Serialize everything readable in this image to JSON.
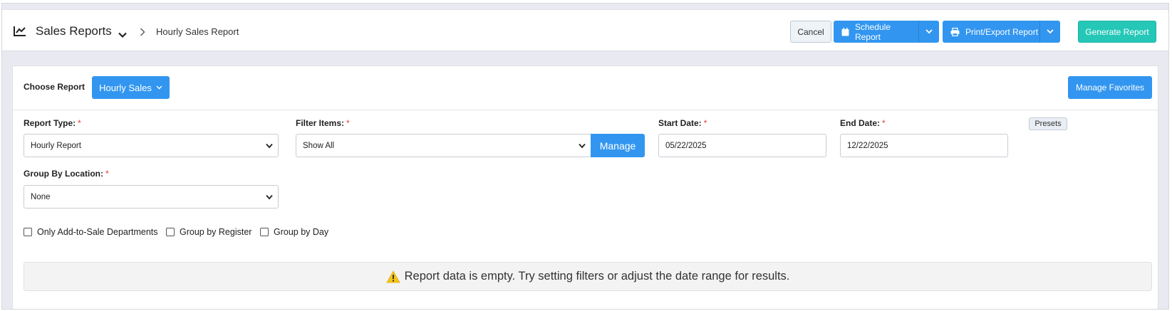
{
  "header": {
    "title": "Sales Reports",
    "current_page": "Hourly Sales Report",
    "icons": {
      "report": "line-chart-icon",
      "caret": "chevron-down-icon",
      "separator": "chevron-right-icon"
    }
  },
  "actions": {
    "cancel": "Cancel",
    "schedule": "Schedule Report",
    "print_export": "Print/Export Report",
    "generate": "Generate Report"
  },
  "report_picker": {
    "label": "Choose Report",
    "selected": "Hourly Sales",
    "favorites": "Manage Favorites"
  },
  "filters": {
    "report_type": {
      "label": "Report Type:",
      "value": "Hourly Report"
    },
    "filter_items": {
      "label": "Filter Items:",
      "value": "Show All",
      "manage": "Manage"
    },
    "start_date": {
      "label": "Start Date:",
      "value": "05/22/2025"
    },
    "end_date": {
      "label": "End Date:",
      "value": "12/22/2025",
      "presets": "Presets"
    },
    "group_by_location": {
      "label": "Group By Location:",
      "value": "None"
    },
    "required_mark": "*"
  },
  "options": [
    {
      "label": "Only Add-to-Sale Departments",
      "checked": false
    },
    {
      "label": "Group by Register",
      "checked": false
    },
    {
      "label": "Group by Day",
      "checked": false
    }
  ],
  "alert": {
    "message": "Report data is empty. Try setting filters or adjust the date range for results.",
    "icon": "warning-icon"
  },
  "colors": {
    "primary": "#3296f0",
    "success": "#25c7b7",
    "required": "#e23b3b",
    "warning": "#f5c518"
  }
}
